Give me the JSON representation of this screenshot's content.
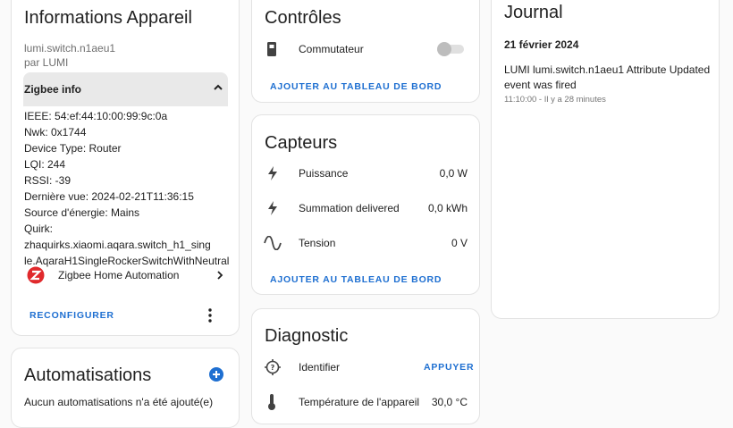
{
  "device_card": {
    "title": "Informations Appareil",
    "model": "lumi.switch.n1aeu1",
    "by": "par LUMI",
    "zigbee_header": "Zigbee info",
    "info_lines": [
      "IEEE: 54:ef:44:10:00:99:9c:0a",
      "Nwk: 0x1744",
      "Device Type: Router",
      "LQI: 244",
      "RSSI: -39",
      "Dernière vue: 2024-02-21T11:36:15",
      "Source d'énergie: Mains",
      "Quirk: zhaquirks.xiaomi.aqara.switch_h1_sing",
      "le.AqaraH1SingleRockerSwitchWithNeutral"
    ],
    "integration": "Zigbee Home Automation",
    "reconfigure": "RECONFIGURER"
  },
  "automations_card": {
    "title": "Automatisations",
    "empty_text": "Aucun automatisations n'a été ajouté(e)"
  },
  "controls_card": {
    "title": "Contrôles",
    "switch_label": "Commutateur",
    "switch_on": false,
    "add_button": "AJOUTER AU TABLEAU DE BORD"
  },
  "sensors_card": {
    "title": "Capteurs",
    "rows": [
      {
        "label": "Puissance",
        "value": "0,0 W",
        "icon": "flash-icon"
      },
      {
        "label": "Summation delivered",
        "value": "0,0 kWh",
        "icon": "flash-outline-icon"
      },
      {
        "label": "Tension",
        "value": "0 V",
        "icon": "sine-wave-icon"
      }
    ],
    "add_button": "AJOUTER AU TABLEAU DE BORD"
  },
  "diagnostic_card": {
    "title": "Diagnostic",
    "identify_label": "Identifier",
    "identify_button": "APPUYER",
    "temp_label": "Température de l'appareil",
    "temp_value": "30,0 °C"
  },
  "journal_card": {
    "title": "Journal",
    "date": "21 février 2024",
    "entry_text": "LUMI lumi.switch.n1aeu1 Attribute Updated event was fired",
    "entry_time": "11:10:00 - Il y a 28 minutes"
  },
  "colors": {
    "accent": "#1e6fd1",
    "zha_red": "#e0292c"
  }
}
